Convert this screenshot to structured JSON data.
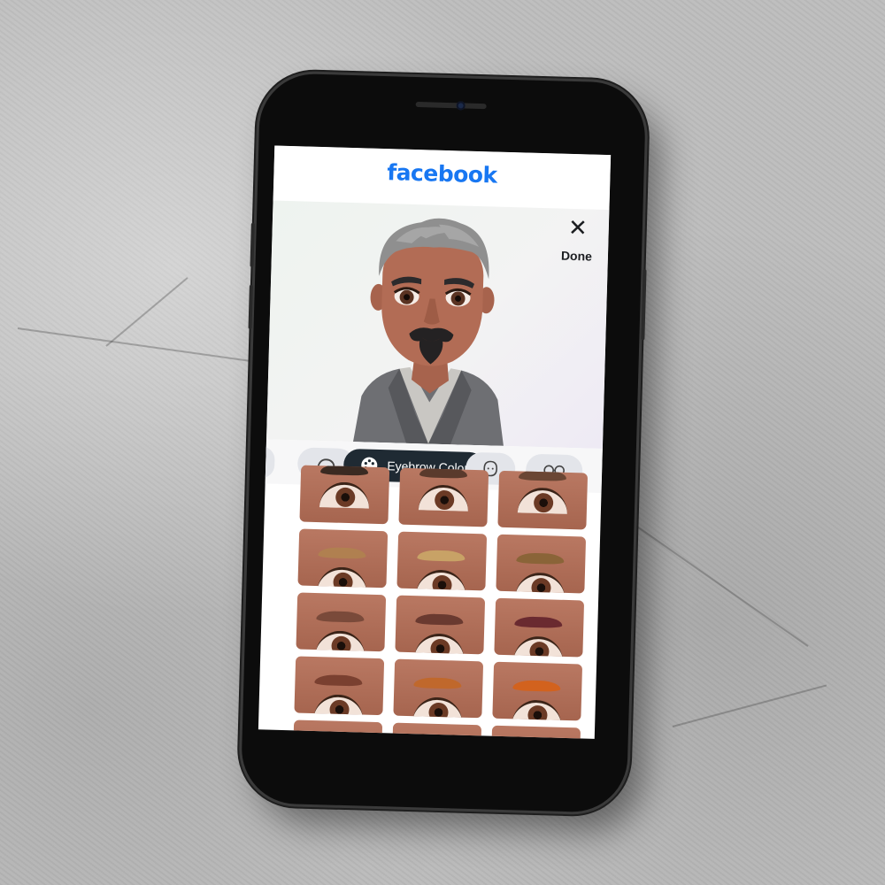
{
  "app": {
    "logo_text": "facebook",
    "brand_color": "#1877f2"
  },
  "editor": {
    "close_icon": "close-icon",
    "done_label": "Done"
  },
  "categories": {
    "active_label": "Eyebrow Color",
    "items": [
      {
        "icon": "partial-chip-icon"
      },
      {
        "icon": "eyebrow-shape-icon"
      },
      {
        "icon": "palette-icon",
        "label": "Eyebrow Color"
      },
      {
        "icon": "face-shape-icon"
      },
      {
        "icon": "glasses-icon"
      }
    ]
  },
  "swatches": {
    "colors": [
      "#3a2a22",
      "#5a3a2c",
      "#6a4634",
      "#b08050",
      "#c8a266",
      "#8a6438",
      "#7a4a3a",
      "#6a3a30",
      "#6a2a30",
      "#7a4030",
      "#c0682c",
      "#d2621e"
    ]
  }
}
